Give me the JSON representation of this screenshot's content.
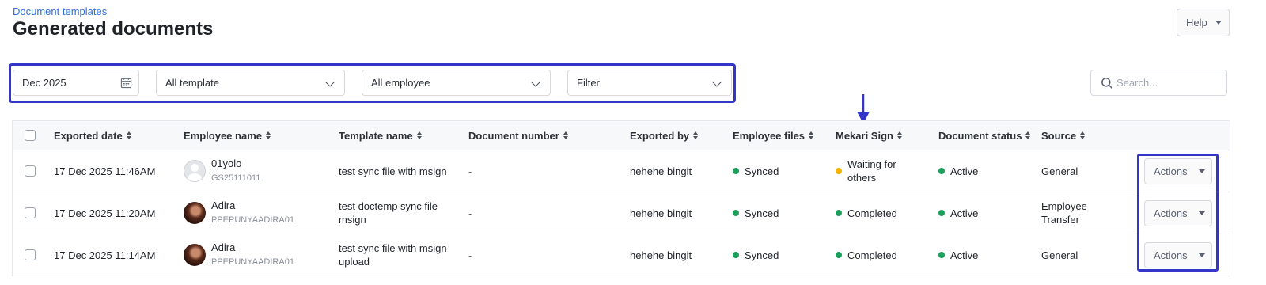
{
  "breadcrumb": "Document templates",
  "page_title": "Generated documents",
  "help_label": "Help",
  "filters": {
    "date": "Dec 2025",
    "template": "All template",
    "employee": "All employee",
    "filter": "Filter"
  },
  "search": {
    "placeholder": "Search..."
  },
  "colors": {
    "accent": "#3336c8",
    "link": "#2f6fdb",
    "synced": "#1aa05a",
    "waiting": "#f5b400",
    "completed": "#1aa05a",
    "active": "#1aa05a"
  },
  "columns": {
    "exported_date": "Exported date",
    "employee_name": "Employee name",
    "template_name": "Template name",
    "document_number": "Document number",
    "exported_by": "Exported by",
    "employee_files": "Employee files",
    "mekari_sign": "Mekari Sign",
    "document_status": "Document status",
    "source": "Source"
  },
  "rows": [
    {
      "exported_date": "17 Dec 2025 11:46AM",
      "employee_name": "01yolo",
      "employee_id": "GS25111011",
      "avatar": "default-avatar",
      "template_name": "test sync file with msign",
      "document_number": "-",
      "exported_by": "hehehe bingit",
      "employee_files": "Synced",
      "mekari_sign": "Waiting for others",
      "mekari_sign_status": "waiting",
      "document_status": "Active",
      "source": "General",
      "actions_label": "Actions"
    },
    {
      "exported_date": "17 Dec 2025 11:20AM",
      "employee_name": "Adira",
      "employee_id": "PPEPUNYAADIRA01",
      "avatar": "photo-avatar",
      "template_name": "test doctemp sync file msign",
      "document_number": "-",
      "exported_by": "hehehe bingit",
      "employee_files": "Synced",
      "mekari_sign": "Completed",
      "mekari_sign_status": "completed",
      "document_status": "Active",
      "source": "Employee Transfer",
      "actions_label": "Actions"
    },
    {
      "exported_date": "17 Dec 2025 11:14AM",
      "employee_name": "Adira",
      "employee_id": "PPEPUNYAADIRA01",
      "avatar": "photo-avatar",
      "template_name": "test sync file with msign upload",
      "document_number": "-",
      "exported_by": "hehehe bingit",
      "employee_files": "Synced",
      "mekari_sign": "Completed",
      "mekari_sign_status": "completed",
      "document_status": "Active",
      "source": "General",
      "actions_label": "Actions"
    }
  ]
}
